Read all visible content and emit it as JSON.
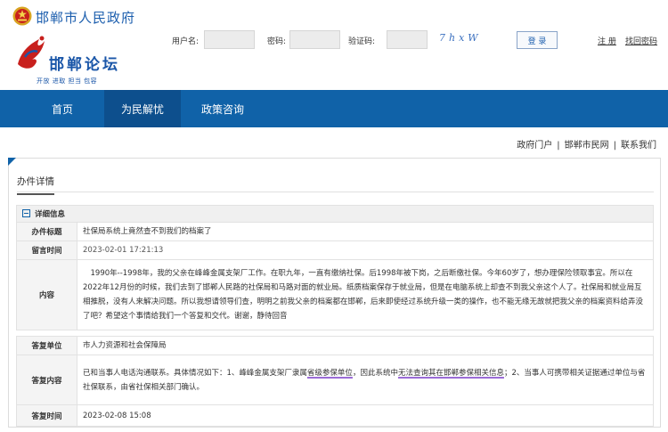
{
  "header": {
    "gov_name": "邯郸市人民政府",
    "forum_name": "邯郸论坛",
    "slogan": "开放 进取 担当 包容",
    "username_label": "用户名:",
    "password_label": "密码:",
    "captcha_label": "验证码:",
    "captcha_text": "7hxW",
    "login_label": "登 录",
    "register_label": "注 册",
    "forgot_label": "找回密码"
  },
  "nav": {
    "items": [
      "首页",
      "为民解忧",
      "政策咨询"
    ]
  },
  "subnav": {
    "links": [
      "政府门户",
      "邯郸市民网",
      "联系我们"
    ]
  },
  "detail": {
    "section_title": "办件详情",
    "info_header": "详细信息",
    "title_key": "办件标题",
    "title_value": "社保局系统上竟然查不到我们的档案了",
    "time_key": "留言时间",
    "time_value": "2023-02-01 17:21:13",
    "content_key": "内容",
    "content_value": "1990年--1998年，我的父亲在峰峰金属支架厂工作。在职九年，一直有缴纳社保。后1998年被下岗，之后断缴社保。今年60岁了，想办理保险领取事宜。所以在2022年12月份的时候，我们去到了邯郸人民路的社保局和马路对面的就业局。纸质档案保存于就业局，但是在电脑系统上却查不到我父亲这个人了。社保局和就业局互相推脱，没有人来解决问题。所以我想请领导们查，明明之前我父亲的档案都在邯郸，后来即使经过系统升级一类的操作，也不能无缘无故就把我父亲的档案资料给弄没了吧？希望这个事情给我们一个答复和交代。谢谢，静待回音",
    "reply_unit_key": "答复单位",
    "reply_unit_value": "市人力资源和社会保障局",
    "reply_content_key": "答复内容",
    "reply_content_part1": "已和当事人电话沟通联系。具体情况如下：1、峰峰金属支架厂隶属",
    "reply_content_hl1": "省级参保单位",
    "reply_content_part2": "，因此系统中",
    "reply_content_hl2": "无法查询其在邯郸参保相关信息",
    "reply_content_part3": "；2、当事人可携带相关证据通过单位与省社保联系，由省社保相关部门确认。",
    "reply_time_key": "答复时间",
    "reply_time_value": "2023-02-08 15:08"
  },
  "colors": {
    "brand_blue": "#1062a8",
    "nav_active": "#0d4f8d",
    "highlight_underline": "#9b6cd6"
  }
}
